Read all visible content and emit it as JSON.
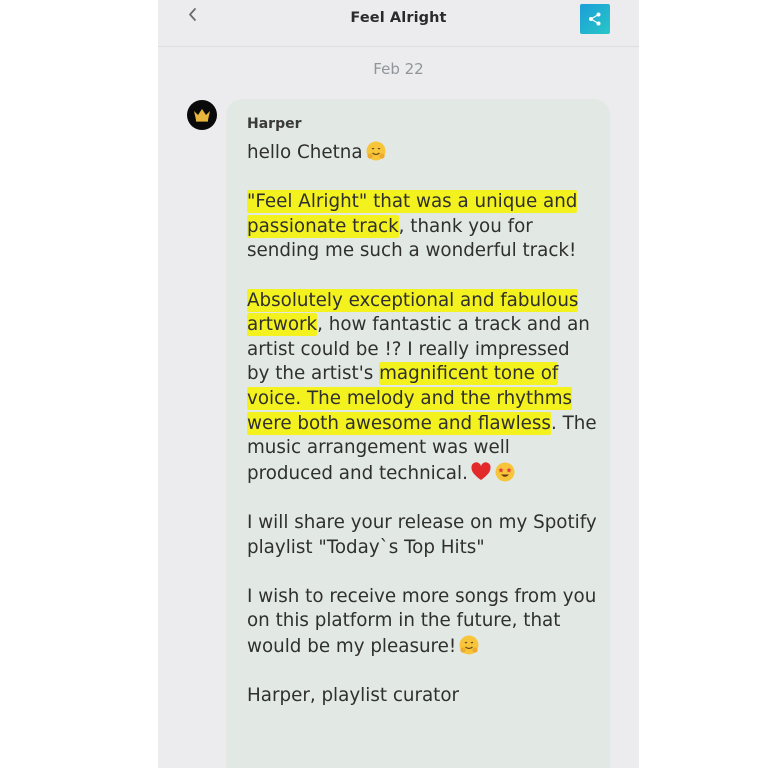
{
  "header": {
    "title": "Feel Alright"
  },
  "date_label": "Feb 22",
  "message": {
    "sender": "Harper",
    "greeting": "hello Chetna",
    "p1_highlight": "\"Feel Alright\" that was a unique and passionate track",
    "p1_rest": ", thank you for sending me such a wonderful track!",
    "p2_highlight_1": "Absolutely exceptional and fabulous artwork",
    "p2_text_1": ", how fantastic a track and an artist could be !? I really impressed by the artist's ",
    "p2_highlight_2": "magnificent tone of voice. The melody and the rhythms were both awesome and flawless",
    "p2_text_2": ". The music arrangement was well produced and technical.",
    "p3": "I will share your release on my Spotify playlist \"Today`s Top Hits\"",
    "p4": "I wish to receive more songs from you on this platform in the future, that would be my pleasure!",
    "signature": "Harper, playlist curator"
  },
  "icons": {
    "back": "chevron-left-icon",
    "share": "share-icon",
    "avatar": "crown-icon",
    "hug": "hugging-face-emoji",
    "heart": "red-heart-emoji",
    "star_eyes": "star-struck-emoji"
  },
  "colors": {
    "highlight": "#f3f21f",
    "share_button": "#1b9ed8",
    "bubble": "#e2e9e5",
    "background": "#ececee"
  }
}
